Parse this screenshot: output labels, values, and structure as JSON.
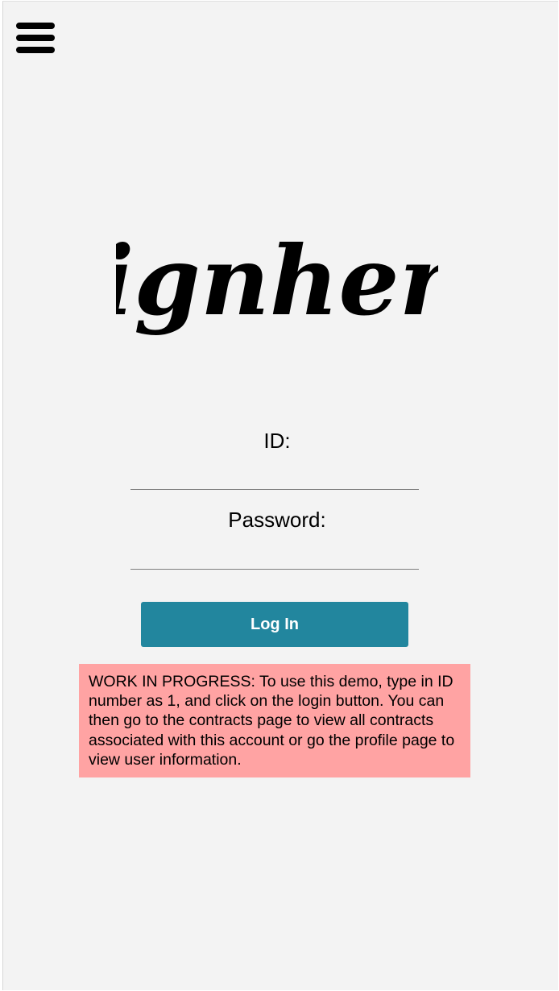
{
  "nav": {
    "menu_icon": "hamburger-menu-icon"
  },
  "brand": {
    "logo_text": "signhere"
  },
  "login_form": {
    "id_label": "ID:",
    "id_value": "",
    "password_label": "Password:",
    "password_value": "",
    "login_button_label": "Log In"
  },
  "notice": {
    "text": "WORK IN PROGRESS: To use this demo, type in ID number as 1, and click on the login button. You can then go to the contracts page to view all contracts associated with this account or go the profile page to view user information."
  },
  "colors": {
    "background": "#f3f3f3",
    "button": "#22869e",
    "notice_background": "#ffa3a3"
  }
}
